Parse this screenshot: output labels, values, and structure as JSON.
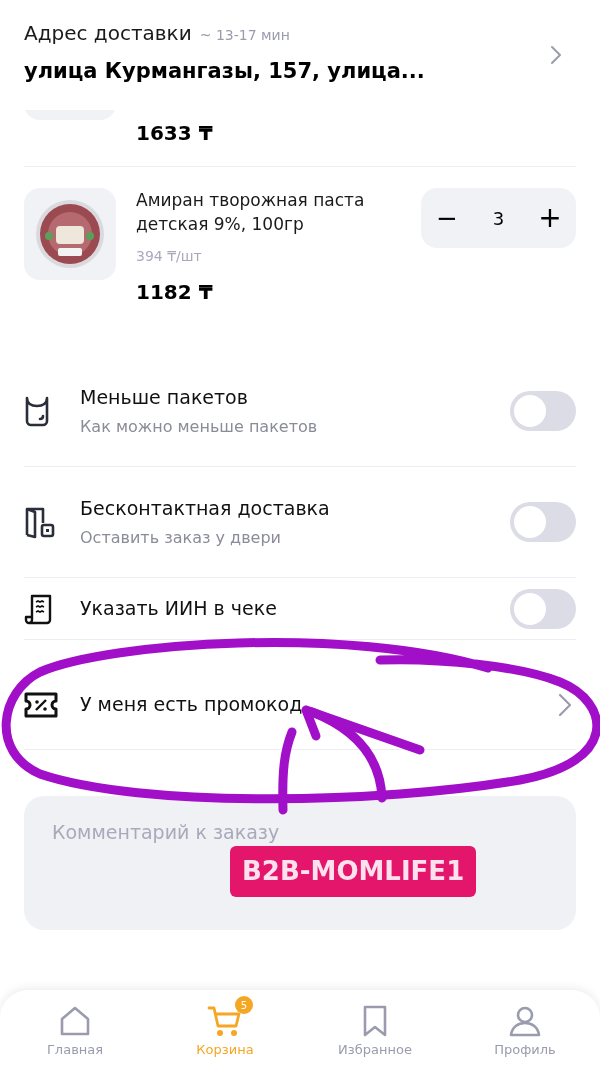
{
  "header": {
    "label": "Адрес доставки",
    "eta": "~ 13-17 мин",
    "address": "улица Курмангазы, 157, улица..."
  },
  "cart_items": [
    {
      "kind": "partial",
      "total": "1633 ₸"
    },
    {
      "kind": "full",
      "name": "Амиран творожная паста детская 9%, 100гр",
      "unit_price": "394 ₸/шт",
      "total": "1182 ₸",
      "quantity": "3",
      "minus": "−",
      "plus": "+"
    }
  ],
  "options": [
    {
      "kind": "toggle",
      "title": "Меньше пакетов",
      "subtitle": "Как можно меньше пакетов",
      "on": false
    },
    {
      "kind": "toggle",
      "title": "Бесконтактная доставка",
      "subtitle": "Оставить заказ у двери",
      "on": false
    },
    {
      "kind": "toggle",
      "title": "Указать ИИН в чеке",
      "on": false
    },
    {
      "kind": "link",
      "title": "У меня есть промокод"
    }
  ],
  "comment": {
    "placeholder": "Комментарий к заказу"
  },
  "sticker": {
    "text": "B2B-MOMLIFE1"
  },
  "bottom_nav": [
    {
      "label": "Главная",
      "selected": false
    },
    {
      "label": "Корзина",
      "selected": true,
      "badge": "5"
    },
    {
      "label": "Избранное",
      "selected": false
    },
    {
      "label": "Профиль",
      "selected": false
    }
  ]
}
